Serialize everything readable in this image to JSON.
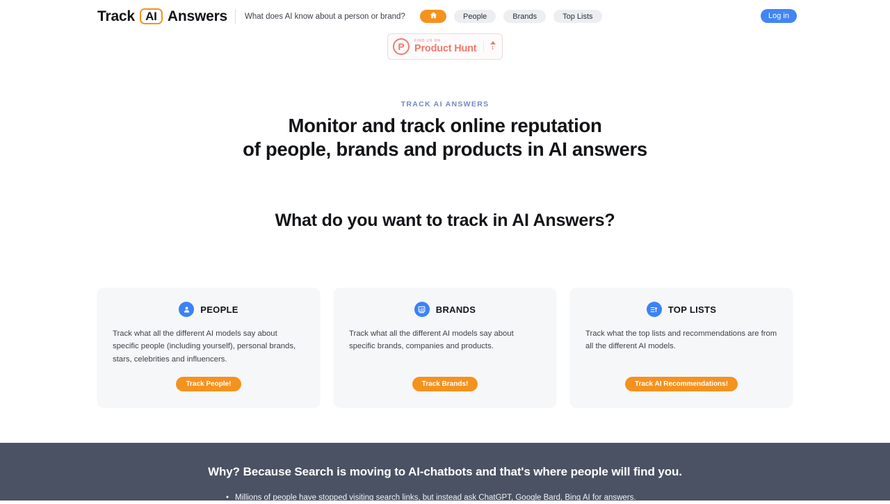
{
  "header": {
    "brand_word1": "Track",
    "brand_ai": "AI",
    "brand_word2": "Answers",
    "tagline": "What does AI know about a person or brand?",
    "login_label": "Log in",
    "nav": [
      {
        "label": "",
        "icon": "home-icon",
        "name": "nav-home",
        "active": true
      },
      {
        "label": "People",
        "icon": "",
        "name": "nav-people",
        "active": false
      },
      {
        "label": "Brands",
        "icon": "",
        "name": "nav-brands",
        "active": false
      },
      {
        "label": "Top Lists",
        "icon": "",
        "name": "nav-top-lists",
        "active": false
      }
    ]
  },
  "product_hunt": {
    "small_text": "FIND US ON",
    "name": "Product Hunt",
    "vote_count": "1"
  },
  "hero": {
    "eyebrow": "TRACK AI ANSWERS",
    "title_line1": "Monitor and track online reputation",
    "title_line2": "of people, brands and products in AI answers"
  },
  "main": {
    "section_title": "What do you want to track in AI Answers?",
    "cards": [
      {
        "icon": "person-icon",
        "title": "PEOPLE",
        "text": "Track what all the different AI models say about specific people (including yourself), personal brands, stars, celebrities and influencers.",
        "button": "Track People!"
      },
      {
        "icon": "storefront-chart-icon",
        "title": "BRANDS",
        "text": "Track what all the different AI models say about specific brands, companies and products.",
        "button": "Track Brands!"
      },
      {
        "icon": "ranking-list-icon",
        "title": "TOP LISTS",
        "text": "Track what the top lists and recommendations are from all the different AI models.",
        "button": "Track AI Recommendations!"
      }
    ]
  },
  "why": {
    "title": "Why? Because Search is moving to AI-chatbots and that's where people will find you.",
    "bullets": [
      "Millions of people have stopped visiting search links, but instead ask ChatGPT, Google Bard, Bing AI for answers."
    ]
  },
  "colors": {
    "accent_orange": "#f5921e",
    "icon_blue": "#3b82f6",
    "login_blue": "#4285f4",
    "dark_section": "#4a5263",
    "eyebrow_blue": "#6f89c4",
    "product_hunt_red": "#ef7a6d"
  }
}
